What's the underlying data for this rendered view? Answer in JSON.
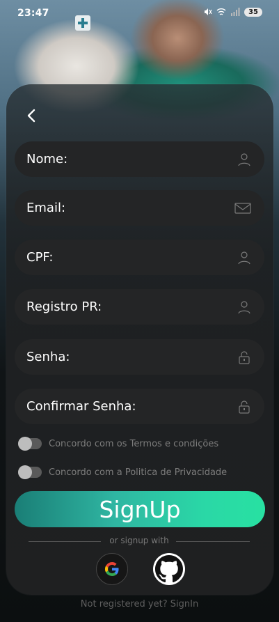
{
  "status_bar": {
    "time": "23:47",
    "battery": "35"
  },
  "form": {
    "back_icon": "chevron-left-icon",
    "fields": [
      {
        "label": "Nome:",
        "icon": "user-icon"
      },
      {
        "label": "Email:",
        "icon": "mail-icon"
      },
      {
        "label": "CPF:",
        "icon": "user-icon"
      },
      {
        "label": "Registro PR:",
        "icon": "user-icon"
      },
      {
        "label": "Senha:",
        "icon": "lock-icon"
      },
      {
        "label": "Confirmar Senha:",
        "icon": "lock-icon"
      }
    ],
    "toggles": [
      {
        "label": "Concordo com os Termos e condições",
        "checked": false
      },
      {
        "label": "Concordo com a Politica de Privacidade",
        "checked": false
      }
    ],
    "submit_label": "SignUp",
    "divider_text": "or signup with",
    "social": [
      "google-icon",
      "github-icon"
    ]
  },
  "footer_text": "Not registered yet? SignIn",
  "colors": {
    "accent_start": "#1a7e76",
    "accent_end": "#28e1a2",
    "field_bg": "#242526"
  }
}
